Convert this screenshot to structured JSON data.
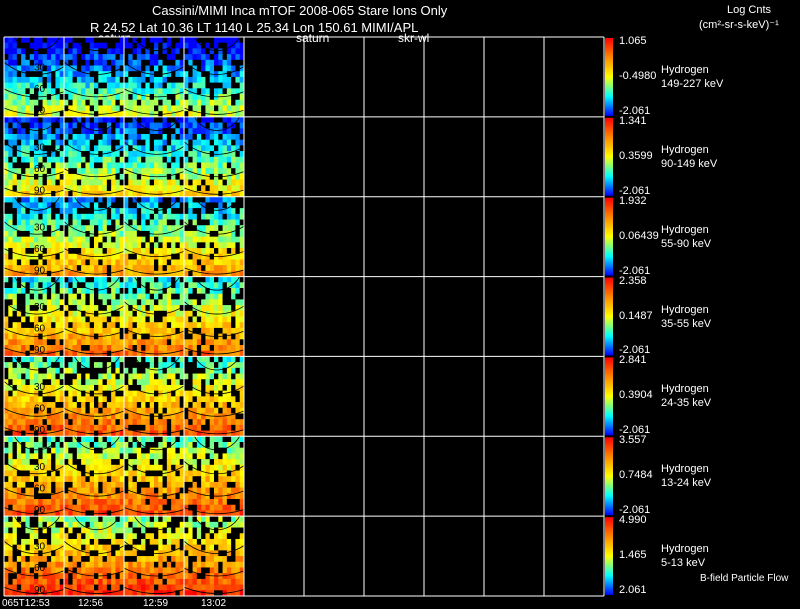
{
  "header": {
    "title": "Cassini/MIMI Inca mTOF  2008-065   Stare    Ions Only",
    "subtitle": "R        24.52 Lat 10.36 LT 1140 L           25.34 Lon          150.61  MIMI/APL",
    "tags": [
      "saturn",
      "saturn",
      "skr-wl"
    ]
  },
  "units": {
    "label": "Log Cnts",
    "value": "(cm²-sr-s-keV)⁻¹"
  },
  "chart_data": {
    "type": "heatmap",
    "species": "Hydrogen",
    "colorscale": [
      "#0000ff",
      "#00ffff",
      "#ffff00",
      "#ff8800",
      "#ff0000"
    ],
    "ring_labels": [
      "30",
      "60",
      "90",
      "120"
    ],
    "time_labels": [
      "065T12:53",
      "12:56",
      "12:59",
      "13:02"
    ],
    "filled_columns": 4,
    "total_columns": 10,
    "bands": [
      {
        "energy": "149-227 keV",
        "cb_max": "1.065",
        "cb_mid": "-0.4980",
        "cb_min": "-2.061",
        "mean_level": 0.12
      },
      {
        "energy": "90-149 keV",
        "cb_max": "1.341",
        "cb_mid": "0.3599",
        "cb_min": "-2.061",
        "mean_level": 0.22
      },
      {
        "energy": "55-90 keV",
        "cb_max": "1.932",
        "cb_mid": "0.06439",
        "cb_min": "-2.061",
        "mean_level": 0.35
      },
      {
        "energy": "35-55 keV",
        "cb_max": "2.358",
        "cb_mid": "0.1487",
        "cb_min": "-2.061",
        "mean_level": 0.45
      },
      {
        "energy": "24-35 keV",
        "cb_max": "2.841",
        "cb_mid": "0.3904",
        "cb_min": "-2.061",
        "mean_level": 0.5
      },
      {
        "energy": "13-24 keV",
        "cb_max": "3.557",
        "cb_mid": "0.7484",
        "cb_min": "-2.061",
        "mean_level": 0.52
      },
      {
        "energy": "5-13 keV",
        "cb_max": "4.990",
        "cb_mid": "1.465",
        "cb_min": "2.061",
        "mean_level": 0.58
      }
    ]
  },
  "footer": {
    "note": "B-field Particle Flow"
  }
}
